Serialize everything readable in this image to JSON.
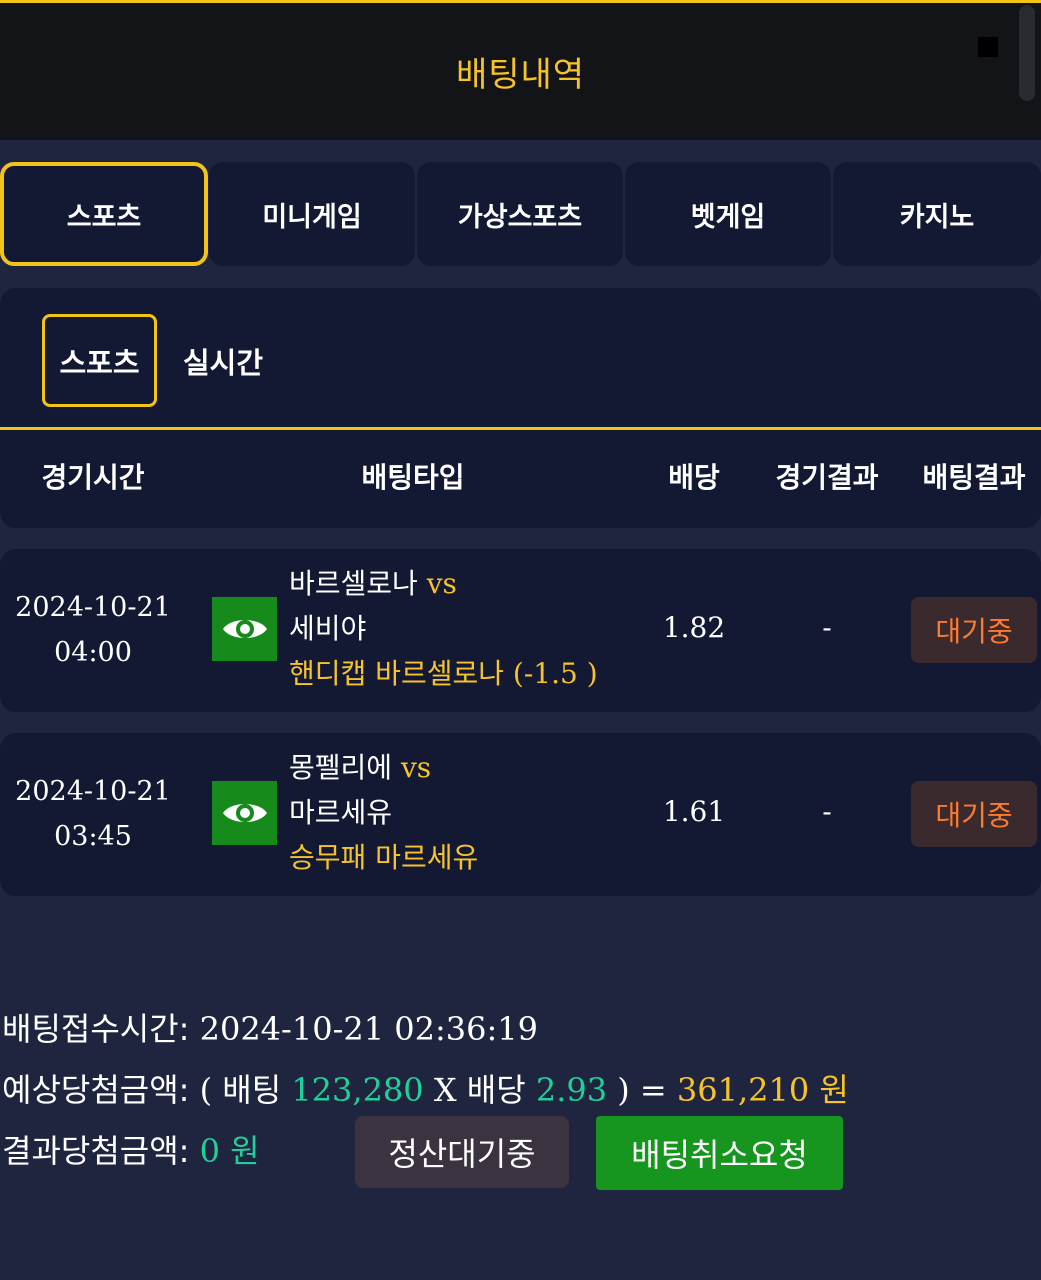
{
  "header": {
    "title": "배팅내역"
  },
  "tabs": [
    "스포츠",
    "미니게임",
    "가상스포츠",
    "벳게임",
    "카지노"
  ],
  "subtabs": [
    "스포츠",
    "실시간"
  ],
  "columns": [
    "경기시간",
    "배팅타입",
    "배당",
    "경기결과",
    "배팅결과"
  ],
  "bets": [
    {
      "date": "2024-10-21",
      "time": "04:00",
      "home": "바르셀로나",
      "vs": "vs",
      "away": "세비야",
      "pick_prefix": "핸디캡 바르셀로나",
      "pick_suffix": "(-1.5 )",
      "odds": "1.82",
      "result": "-",
      "status": "대기중"
    },
    {
      "date": "2024-10-21",
      "time": "03:45",
      "home": "몽펠리에",
      "vs": "vs",
      "away": "마르세유",
      "pick_prefix": "승무패 마르세유",
      "pick_suffix": "",
      "odds": "1.61",
      "result": "-",
      "status": "대기중"
    }
  ],
  "summary": {
    "time_label": "배팅접수시간:",
    "time_value": "2024-10-21 02:36:19",
    "expected_label": "예상당첨금액:",
    "paren_open": "(",
    "bet_label": "배팅",
    "bet_amount": "123,280",
    "times": "X",
    "odds_label": "배당",
    "odds_value": "2.93",
    "paren_close": ") =",
    "expected_amount": "361,210",
    "won": "원",
    "result_label": "결과당첨금액:",
    "result_amount": "0",
    "result_won": "원"
  },
  "buttons": {
    "pending": "정산대기중",
    "cancel": "배팅취소요청"
  },
  "colors": {
    "accent": "#f2c418",
    "panel": "#141933",
    "background": "#20253f",
    "green": "#17961f",
    "teal": "#1ed09a",
    "orange": "#ff7a2e"
  },
  "icons": {
    "view": "eye-icon"
  }
}
